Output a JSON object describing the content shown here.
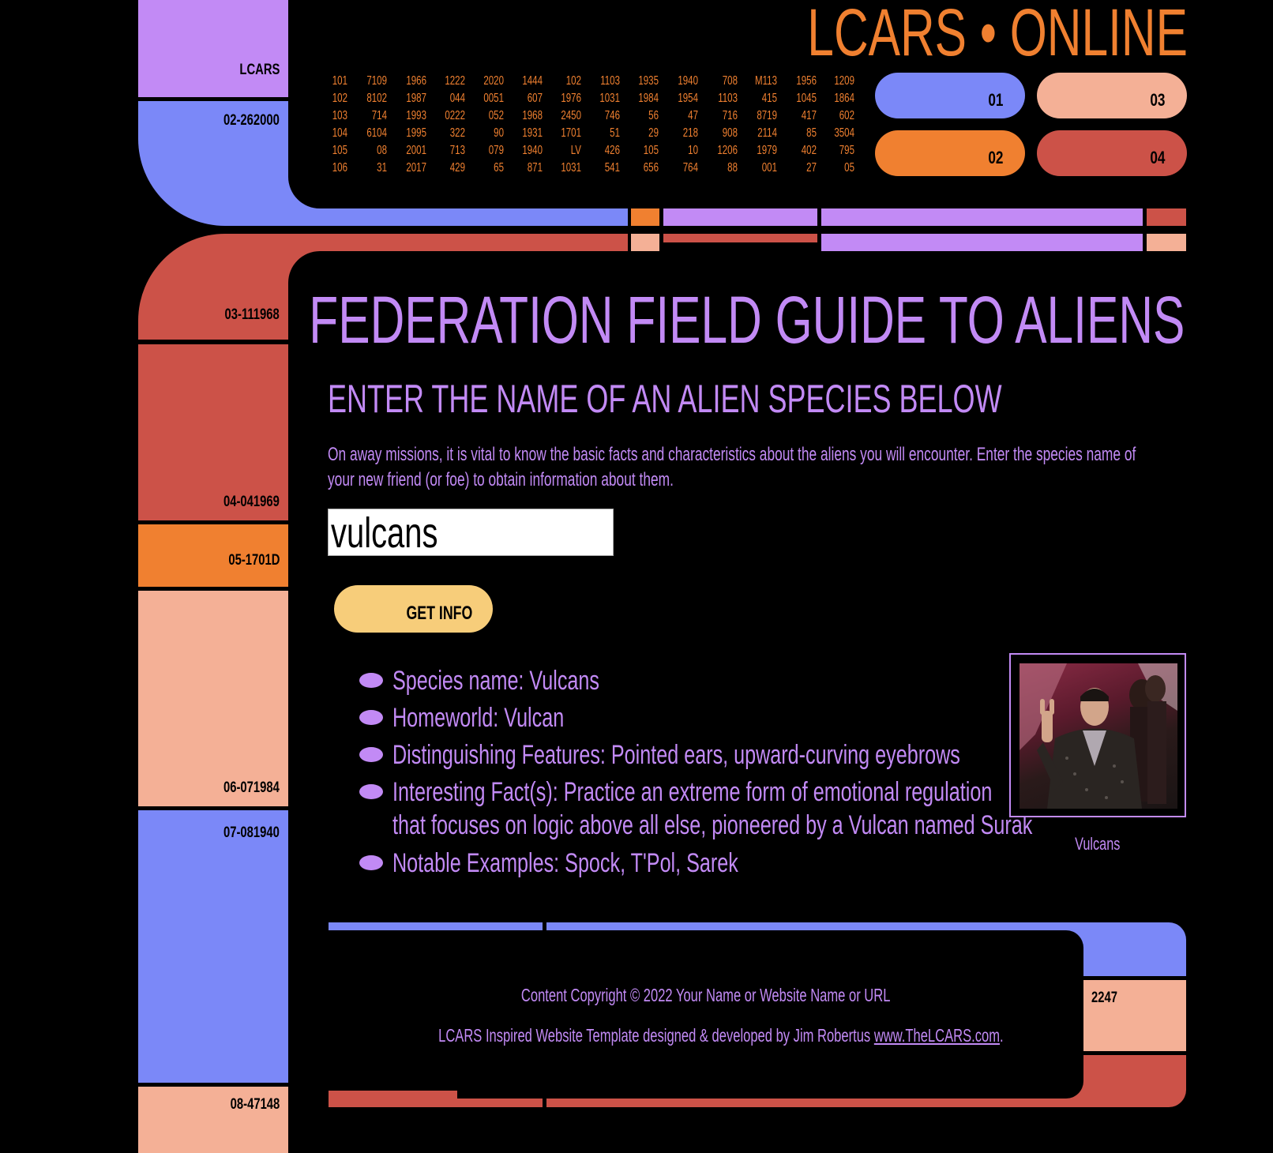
{
  "header": {
    "title": "LCARS • ONLINE",
    "numbers": [
      [
        "101",
        "102",
        "103",
        "104",
        "105",
        "106"
      ],
      [
        "7109",
        "8102",
        "714",
        "6104",
        "08",
        "31"
      ],
      [
        "1966",
        "1987",
        "1993",
        "1995",
        "2001",
        "2017"
      ],
      [
        "1222",
        "044",
        "0222",
        "322",
        "713",
        "429"
      ],
      [
        "2020",
        "0051",
        "052",
        "90",
        "079",
        "65"
      ],
      [
        "1444",
        "607",
        "1968",
        "1931",
        "1940",
        "871"
      ],
      [
        "102",
        "1976",
        "2450",
        "1701",
        "LV",
        "1031"
      ],
      [
        "1103",
        "1031",
        "746",
        "51",
        "426",
        "541"
      ],
      [
        "1935",
        "1984",
        "56",
        "29",
        "105",
        "656"
      ],
      [
        "1940",
        "1954",
        "47",
        "218",
        "10",
        "764"
      ],
      [
        "708",
        "1103",
        "716",
        "908",
        "1206",
        "88"
      ],
      [
        "M113",
        "415",
        "8719",
        "2114",
        "1979",
        "001"
      ],
      [
        "1956",
        "1045",
        "417",
        "85",
        "402",
        "27"
      ],
      [
        "1209",
        "1864",
        "602",
        "3504",
        "795",
        "05"
      ]
    ],
    "buttons": [
      {
        "label": "01",
        "color": "#7b88f8"
      },
      {
        "label": "02",
        "color": "#f08030"
      },
      {
        "label": "03",
        "color": "#f4b096"
      },
      {
        "label": "04",
        "color": "#cc5248"
      }
    ]
  },
  "sidebar": {
    "top_label": "LCARS",
    "labels": [
      "02-262000",
      "03-111968",
      "04-041969",
      "05-1701D",
      "06-071984",
      "07-081940",
      "08-47148"
    ]
  },
  "main": {
    "title": "FEDERATION FIELD GUIDE TO ALIENS",
    "subtitle": "ENTER THE NAME OF AN ALIEN SPECIES BELOW",
    "intro_line1": "On away missions, it is vital to know the basic facts and characteristics about the aliens you will encounter. Enter the species name of",
    "intro_line2": "your new friend (or foe) to obtain information about them.",
    "search_value": "vulcans",
    "button_label": "GET INFO",
    "facts": [
      "Species name: Vulcans",
      "Homeworld: Vulcan",
      "Distinguishing Features: Pointed ears, upward-curving eyebrows",
      "Interesting Fact(s): Practice an extreme form of emotional regulation",
      "that focuses on logic above all else, pioneered by a Vulcan named Surak",
      "Notable Examples: Spock, T'Pol, Sarek"
    ],
    "image_caption": "Vulcans"
  },
  "footer": {
    "copyright": "Content Copyright © 2022 Your Name or Website Name or URL",
    "credit_text": "LCARS Inspired Website Template designed & developed by Jim Robertus",
    "credit_link": "www.TheLCARS.com",
    "credit_end": ".",
    "side_label": "2247"
  },
  "colors": {
    "purple": "#c28af5",
    "blue": "#7b88f8",
    "orange": "#f08030",
    "peach": "#f4b096",
    "red": "#cc5248",
    "gold": "#f7cd7a"
  }
}
